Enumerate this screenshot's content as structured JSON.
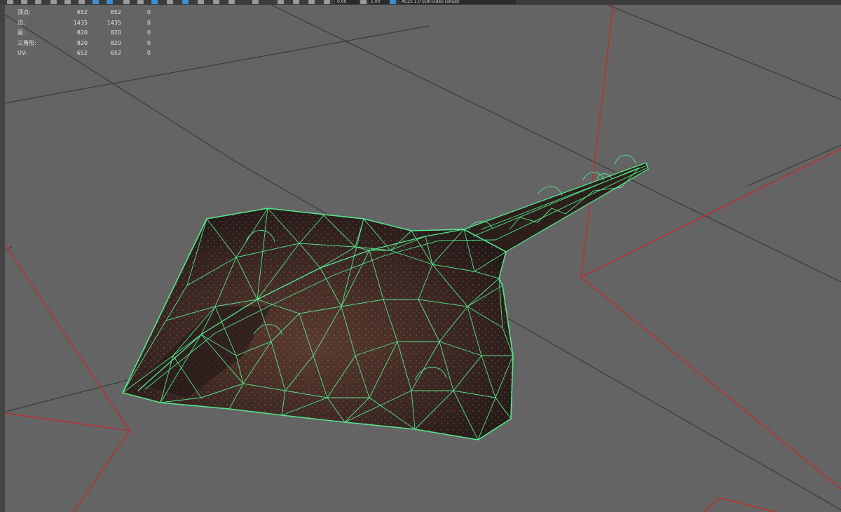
{
  "toolbar": {
    "field_a": "0.00",
    "field_b": "1.00",
    "color_space": "ACES 1.0 SDR-video (sRGB)"
  },
  "heads_up_display": {
    "rows": [
      {
        "label": "顶点:",
        "v1": "652",
        "v2": "652",
        "v3": "0"
      },
      {
        "label": "边:",
        "v1": "1435",
        "v2": "1435",
        "v3": "0"
      },
      {
        "label": "面:",
        "v1": "820",
        "v2": "820",
        "v3": "0"
      },
      {
        "label": "三角形:",
        "v1": "820",
        "v2": "820",
        "v3": "0"
      },
      {
        "label": "UV:",
        "v1": "652",
        "v2": "652",
        "v3": "0"
      }
    ]
  },
  "icons": [
    "toolbar-tool-icon",
    "wireframe-mesh",
    "ground-grid"
  ],
  "colors": {
    "viewport_bg": "#646464",
    "grid_line": "#3a3a3a",
    "grid_axis_red": "#c8282a",
    "wireframe": "#55e68c",
    "surface": "#3a2622"
  }
}
